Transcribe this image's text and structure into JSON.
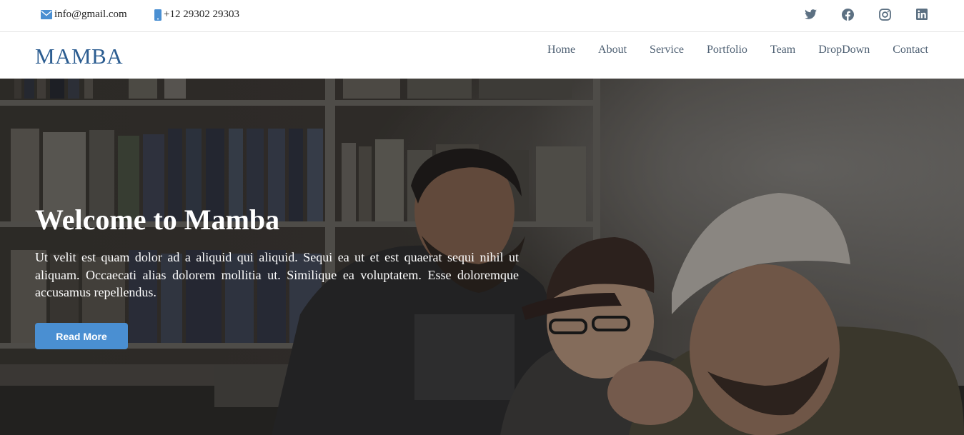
{
  "topbar": {
    "email": "info@gmail.com",
    "phone": "+12 29302 29303",
    "email_icon": "envelope-icon",
    "phone_icon": "phone-icon",
    "socials": [
      "twitter-icon",
      "facebook-icon",
      "instagram-icon",
      "linkedin-icon"
    ]
  },
  "brand": {
    "logo": "MAMBA",
    "color": "#2c5d91"
  },
  "nav": {
    "items": [
      "Home",
      "About",
      "Service",
      "Portfolio",
      "Team",
      "DropDown",
      "Contact"
    ]
  },
  "hero": {
    "title": "Welcome to Mamba",
    "text": "Ut velit est quam dolor ad a aliquid qui aliquid. Sequi ea ut et est quaerat sequi nihil ut aliquam. Occaecati alias dolorem mollitia ut. Similique ea voluptatem. Esse doloremque accusamus repellendus.",
    "button": "Read More",
    "button_color": "#4a8fd2"
  }
}
